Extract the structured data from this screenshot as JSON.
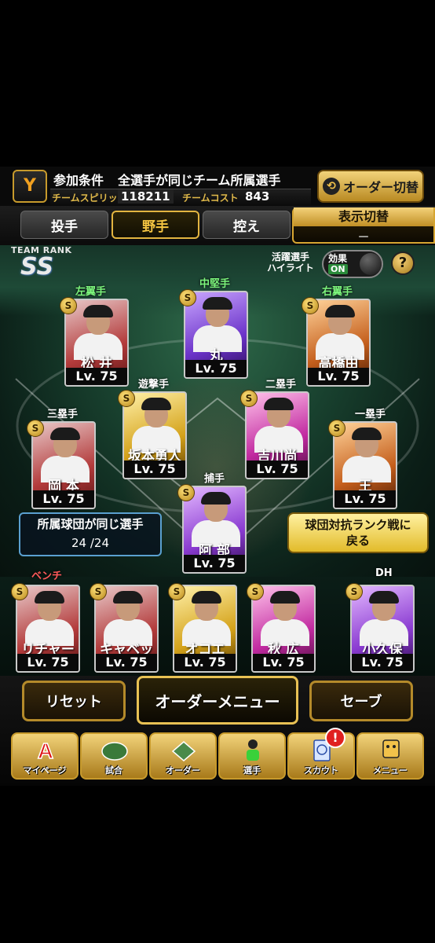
{
  "header": {
    "condition_label": "参加条件",
    "condition_text": "全選手が同じチーム所属選手",
    "spirit_label": "チームスピリッツ",
    "spirit_value": "118211",
    "cost_label": "チームコスト",
    "cost_value": "843",
    "order_switch_label": "オーダー切替"
  },
  "tabs": [
    {
      "label": "投手",
      "active": false
    },
    {
      "label": "野手",
      "active": true
    },
    {
      "label": "控え",
      "active": false
    }
  ],
  "display_toggle": {
    "title": "表示切替",
    "value": "－"
  },
  "team_rank": {
    "label": "TEAM RANK",
    "value": "SS"
  },
  "highlight": {
    "label_line1": "活躍選手",
    "label_line2": "ハイライト",
    "effect_label": "効果",
    "state": "ON"
  },
  "help_label": "?",
  "positions": {
    "lf": {
      "pos": "左翼手",
      "name": "松 井",
      "level": "Lv. 75"
    },
    "cf": {
      "pos": "中堅手",
      "name": "丸",
      "level": "Lv. 75"
    },
    "rf": {
      "pos": "右翼手",
      "name": "高橋由",
      "level": "Lv. 75"
    },
    "ss": {
      "pos": "遊撃手",
      "name": "坂本勇人",
      "level": "Lv. 75"
    },
    "b2": {
      "pos": "二塁手",
      "name": "吉川尚",
      "level": "Lv. 75"
    },
    "b3": {
      "pos": "三塁手",
      "name": "岡 本",
      "level": "Lv. 75"
    },
    "b1": {
      "pos": "一塁手",
      "name": "王",
      "level": "Lv. 75"
    },
    "c": {
      "pos": "捕手",
      "name": "阿 部",
      "level": "Lv. 75"
    }
  },
  "same_team": {
    "label": "所属球団が同じ選手",
    "count": "24 /24"
  },
  "rank_battle_button": {
    "line1": "球団対抗ランク戦に",
    "line2": "戻る"
  },
  "bench": {
    "label": "ベンチ",
    "dh_label": "DH",
    "players": [
      {
        "name": "リチャード",
        "level": "Lv. 75"
      },
      {
        "name": "キャベッジ",
        "level": "Lv. 75"
      },
      {
        "name": "オコエ",
        "level": "Lv. 75"
      },
      {
        "name": "秋 広",
        "level": "Lv. 75"
      },
      {
        "name": "小久保",
        "level": "Lv. 75"
      }
    ]
  },
  "buttons": {
    "reset": "リセット",
    "order_menu": "オーダーメニュー",
    "save": "セーブ"
  },
  "nav": [
    {
      "label": "マイページ"
    },
    {
      "label": "試合"
    },
    {
      "label": "オーダー"
    },
    {
      "label": "選手"
    },
    {
      "label": "スカウト"
    },
    {
      "label": "メニュー"
    }
  ],
  "notification": "!",
  "badge": "S",
  "team_logo_glyph": "Y",
  "switch_glyph": "⟲"
}
